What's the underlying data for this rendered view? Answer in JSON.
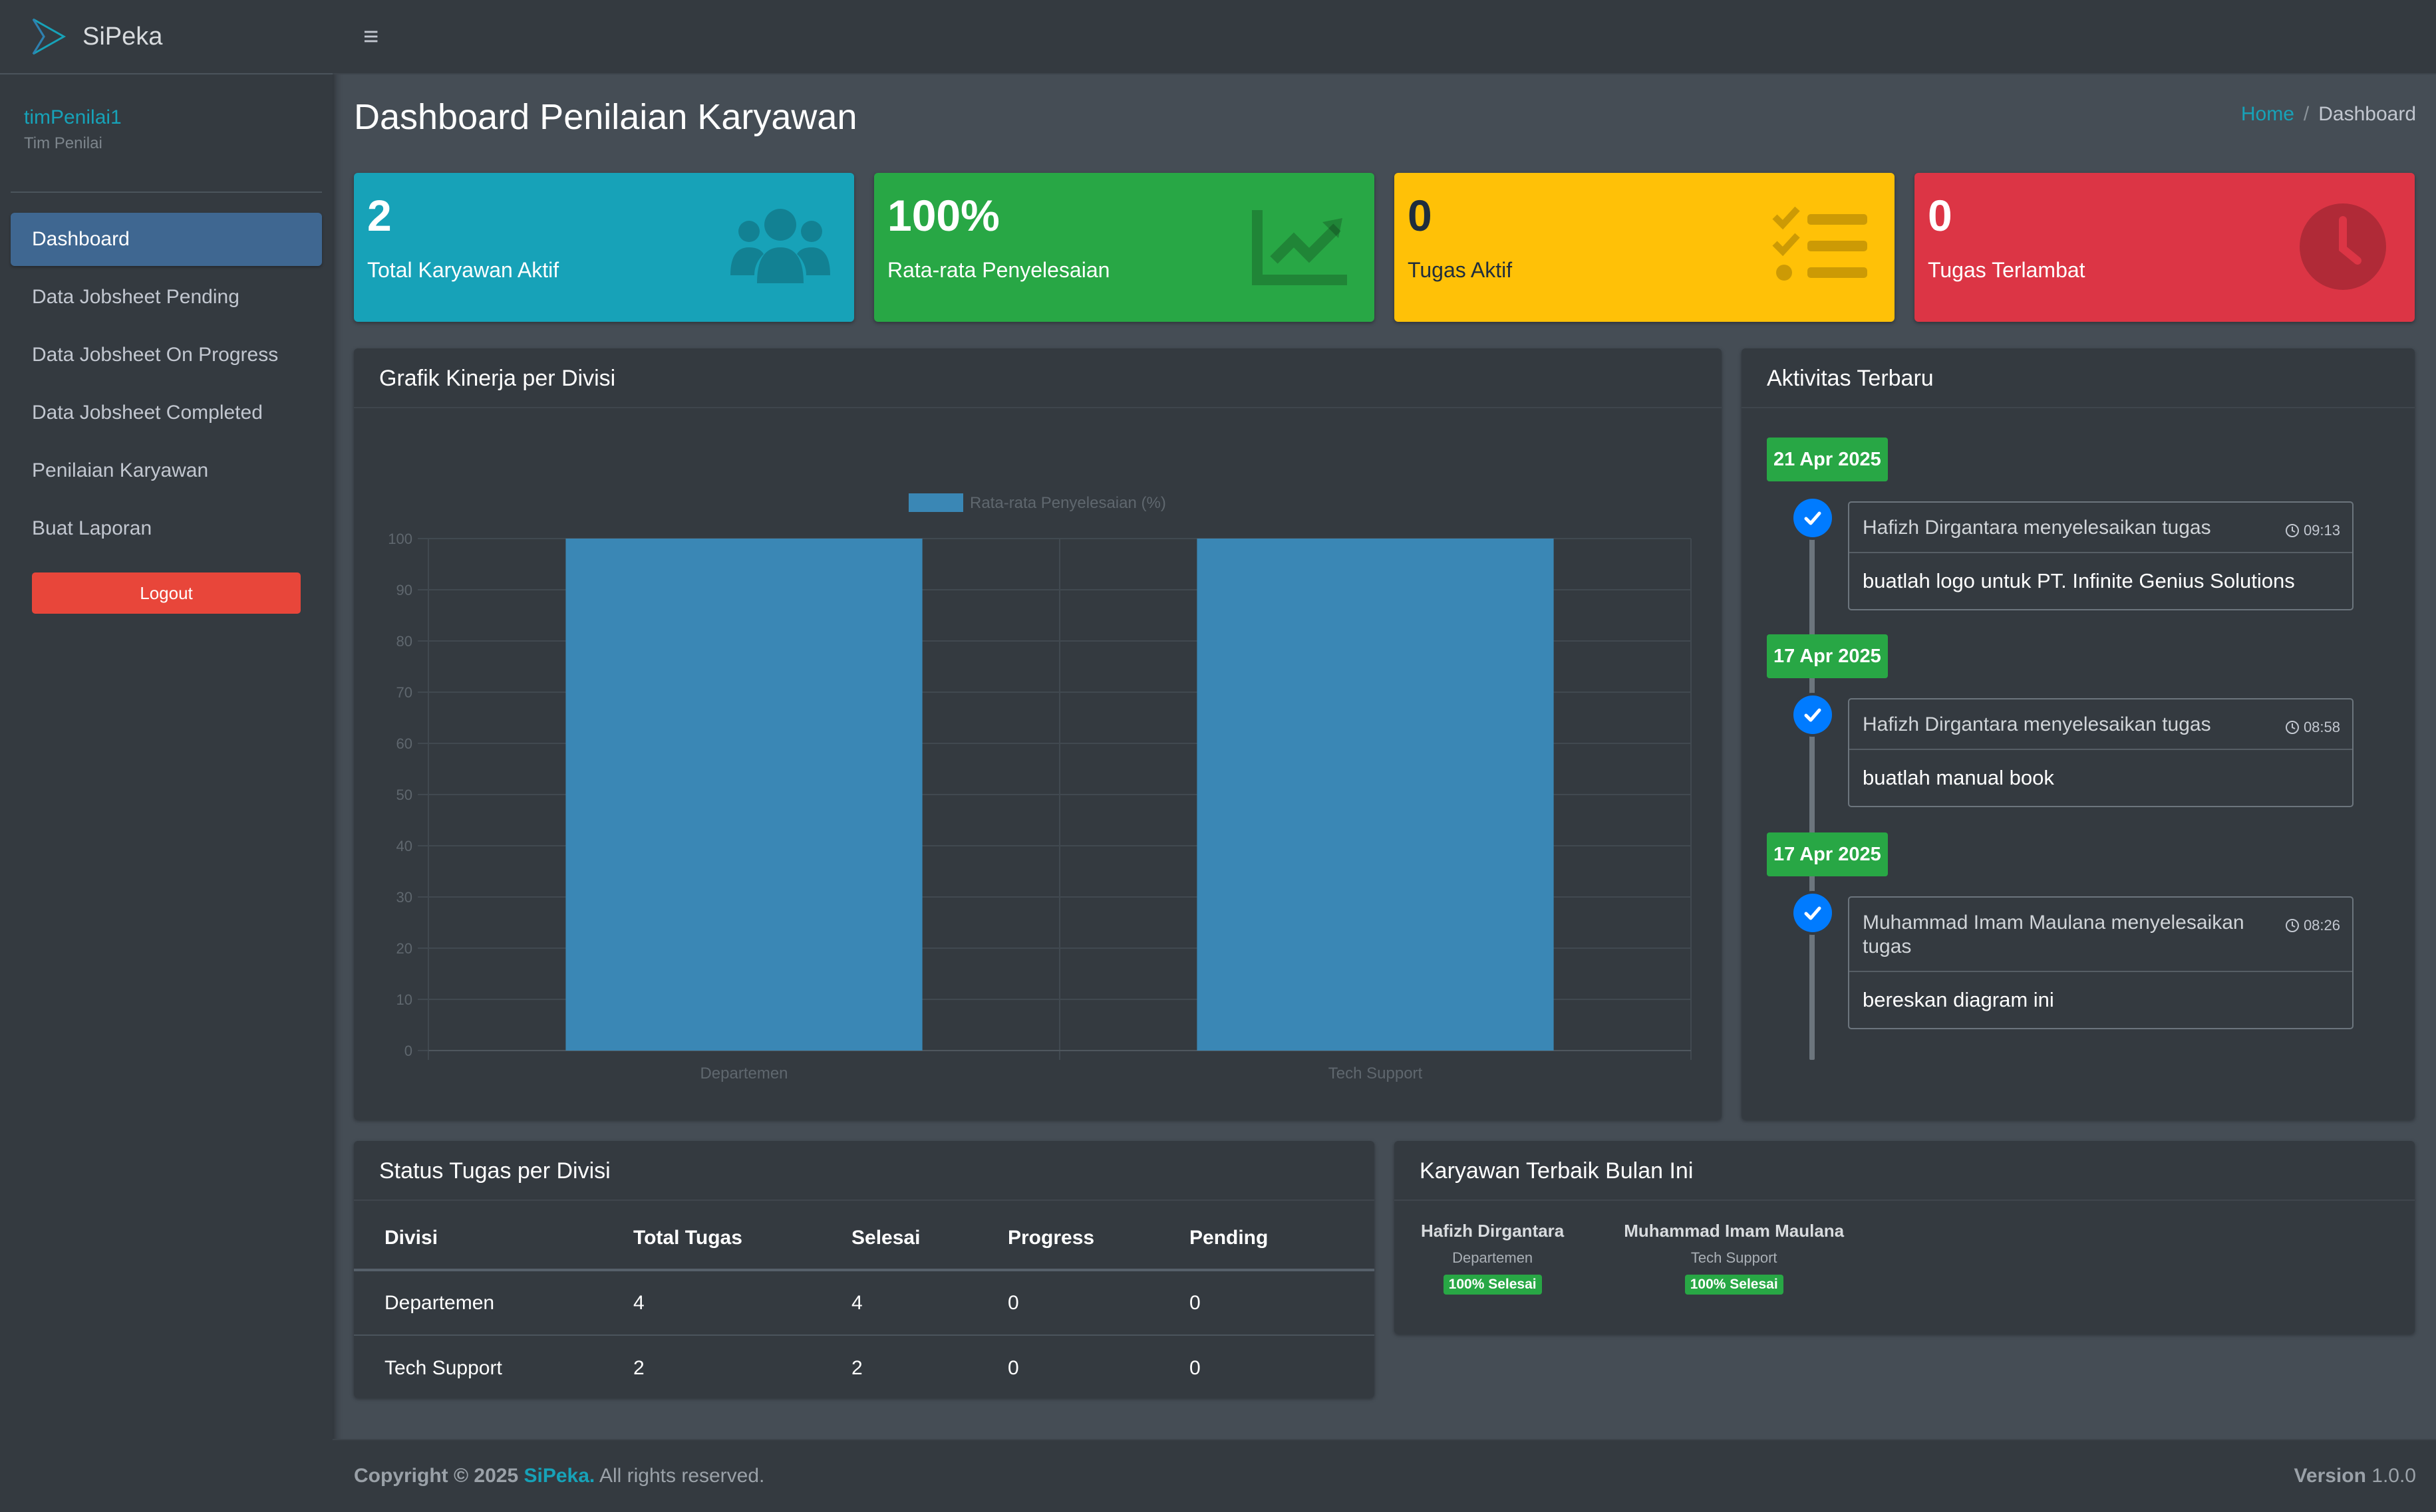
{
  "app": {
    "name": "SiPeka"
  },
  "user": {
    "name": "timPenilai1",
    "role": "Tim Penilai"
  },
  "sidebar": {
    "items": [
      {
        "label": "Dashboard",
        "active": true
      },
      {
        "label": "Data Jobsheet Pending"
      },
      {
        "label": "Data Jobsheet On Progress"
      },
      {
        "label": "Data Jobsheet Completed"
      },
      {
        "label": "Penilaian Karyawan"
      },
      {
        "label": "Buat Laporan"
      }
    ],
    "logout_label": "Logout"
  },
  "header": {
    "menu_icon": "hamburger-icon"
  },
  "page": {
    "title": "Dashboard Penilaian Karyawan"
  },
  "breadcrumb": {
    "home": "Home",
    "separator": "/",
    "current": "Dashboard"
  },
  "stats": [
    {
      "value": "2",
      "label": "Total Karyawan Aktif",
      "icon": "users-icon",
      "color": "#17a2b8"
    },
    {
      "value": "100%",
      "label": "Rata-rata Penyelesaian",
      "icon": "chart-line-icon",
      "color": "#28a745"
    },
    {
      "value": "0",
      "label": "Tugas Aktif",
      "icon": "tasks-icon",
      "color": "#ffc107"
    },
    {
      "value": "0",
      "label": "Tugas Terlambat",
      "icon": "clock-icon",
      "color": "#dc3545"
    }
  ],
  "chart_card": {
    "title": "Grafik Kinerja per Divisi"
  },
  "chart_data": {
    "type": "bar",
    "categories": [
      "Departemen",
      "Tech Support"
    ],
    "series": [
      {
        "name": "Rata-rata Penyelesaian (%)",
        "values": [
          100,
          100
        ],
        "color": "#3a87b5"
      }
    ],
    "ylim": [
      0,
      100
    ],
    "yticks": [
      0,
      10,
      20,
      30,
      40,
      50,
      60,
      70,
      80,
      90,
      100
    ],
    "legend": "top",
    "grid": true
  },
  "activity": {
    "title": "Aktivitas Terbaru",
    "entries": [
      {
        "date": "21 Apr 2025",
        "header": "Hafizh Dirgantara menyelesaikan tugas",
        "time": "09:13",
        "body": "buatlah logo untuk PT. Infinite Genius Solutions"
      },
      {
        "date": "17 Apr 2025",
        "header": "Hafizh Dirgantara menyelesaikan tugas",
        "time": "08:58",
        "body": "buatlah manual book"
      },
      {
        "date": "17 Apr 2025",
        "header": "Muhammad Imam Maulana menyelesaikan tugas",
        "time": "08:26",
        "body": "bereskan diagram ini"
      }
    ]
  },
  "status_table": {
    "title": "Status Tugas per Divisi",
    "columns": [
      "Divisi",
      "Total Tugas",
      "Selesai",
      "Progress",
      "Pending"
    ],
    "rows": [
      [
        "Departemen",
        "4",
        "4",
        "0",
        "0"
      ],
      [
        "Tech Support",
        "2",
        "2",
        "0",
        "0"
      ]
    ]
  },
  "best": {
    "title": "Karyawan Terbaik Bulan Ini",
    "employees": [
      {
        "name": "Hafizh Dirgantara",
        "dept": "Departemen",
        "badge": "100% Selesai"
      },
      {
        "name": "Muhammad Imam Maulana",
        "dept": "Tech Support",
        "badge": "100% Selesai"
      }
    ]
  },
  "footer": {
    "copyright": "Copyright © 2025",
    "brand": "SiPeka.",
    "rights": "All rights reserved.",
    "version_label": "Version",
    "version": "1.0.0"
  }
}
